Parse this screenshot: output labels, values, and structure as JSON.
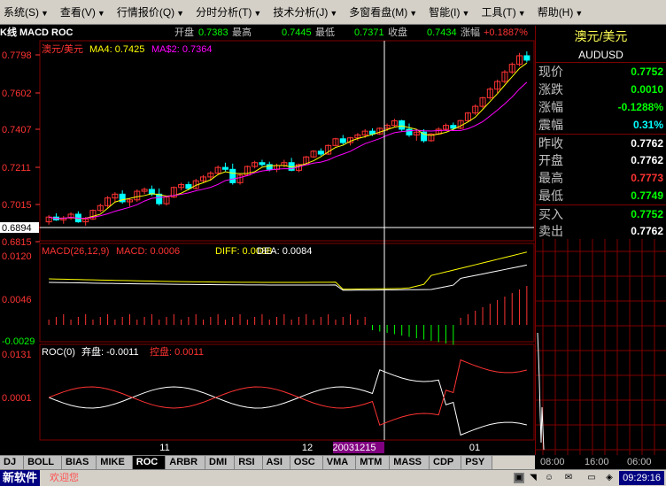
{
  "menu": [
    "系统(S)",
    "查看(V)",
    "行情报价(Q)",
    "分时分析(T)",
    "技术分析(J)",
    "多窗看盘(M)",
    "智能(I)",
    "工具(T)",
    "帮助(H)"
  ],
  "chart_header": {
    "title": "K线 MACD ROC",
    "open_label": "开盘",
    "open": "0.7383",
    "high_label": "最高",
    "high": "0.7445",
    "low_label": "最低",
    "low": "0.7371",
    "close_label": "收盘",
    "close": "0.7434",
    "change_label": "涨幅",
    "change": "+0.1887%"
  },
  "price_panel": {
    "name": "澳元/美元",
    "ma4_label": "MA4: 0.7425",
    "ma52_label": "MA$2: 0.7364",
    "y_ticks": [
      "0.7798",
      "0.7602",
      "0.7407",
      "0.7211",
      "0.7015",
      "0.6894",
      "0.6815"
    ]
  },
  "macd_panel": {
    "label": "MACD(26,12,9)",
    "macd": "MACD: 0.0006",
    "diff": "DIFF: 0.0088",
    "dea": "DEA: 0.0084",
    "y_ticks": [
      "0.0120",
      "0.0046",
      "-0.0029"
    ]
  },
  "roc_panel": {
    "label": "ROC(0)",
    "aband": "弃盘: -0.0011",
    "control": "控盘: 0.0011",
    "y_ticks": [
      "0.0131",
      "0.0001"
    ]
  },
  "x_axis": {
    "labels": [
      "11",
      "12",
      "20031215",
      "01"
    ]
  },
  "quote": {
    "name": "澳元/美元",
    "code": "AUDUSD",
    "rows": [
      {
        "label": "现价",
        "value": "0.7752",
        "color": "#00ff00"
      },
      {
        "label": "涨跌",
        "value": "0.0010",
        "color": "#00ff00"
      },
      {
        "label": "涨幅",
        "value": "-0.1288%",
        "color": "#00ff00"
      },
      {
        "label": "震幅",
        "value": "0.31%",
        "color": "#00ffff"
      },
      {
        "label": "昨收",
        "value": "0.7762",
        "color": "#ffffff"
      },
      {
        "label": "开盘",
        "value": "0.7762",
        "color": "#ffffff"
      },
      {
        "label": "最高",
        "value": "0.7773",
        "color": "#ff3333"
      },
      {
        "label": "最低",
        "value": "0.7749",
        "color": "#00ff00"
      },
      {
        "label": "买入",
        "value": "0.7752",
        "color": "#00ff00"
      },
      {
        "label": "卖出",
        "value": "0.7762",
        "color": "#ffffff"
      }
    ]
  },
  "tabs": [
    "DJ",
    "BOLL",
    "BIAS",
    "MIKE",
    "ROC",
    "ARBR",
    "DMI",
    "RSI",
    "ASI",
    "OSC",
    "VMA",
    "MTM",
    "MASS",
    "CDP",
    "PSY"
  ],
  "active_tab": "ROC",
  "time_axis": [
    "08:00",
    "16:00",
    "06:00"
  ],
  "status": {
    "brand": "新软件",
    "welcome": "欢迎您",
    "clock": "09:29:16"
  },
  "colors": {
    "up": "#ff3333",
    "down": "#00ffff",
    "frame": "#800000",
    "ma4": "#ffff00",
    "ma52": "#ff00ff",
    "dea": "#ffff00",
    "diff": "#ffffff"
  },
  "chart_data": {
    "type": "candlestick",
    "ylim": [
      0.6815,
      0.7798
    ],
    "candles": [
      [
        0.6905,
        0.694,
        0.689,
        0.693
      ],
      [
        0.693,
        0.695,
        0.691,
        0.6915
      ],
      [
        0.6915,
        0.6935,
        0.6895,
        0.6925
      ],
      [
        0.6925,
        0.6955,
        0.6915,
        0.6945
      ],
      [
        0.6945,
        0.696,
        0.69,
        0.6905
      ],
      [
        0.6905,
        0.693,
        0.6885,
        0.692
      ],
      [
        0.692,
        0.697,
        0.6915,
        0.6965
      ],
      [
        0.6965,
        0.7,
        0.6955,
        0.699
      ],
      [
        0.699,
        0.704,
        0.698,
        0.703
      ],
      [
        0.703,
        0.706,
        0.701,
        0.705
      ],
      [
        0.705,
        0.707,
        0.7,
        0.701
      ],
      [
        0.701,
        0.703,
        0.6985,
        0.702
      ],
      [
        0.702,
        0.7075,
        0.701,
        0.7065
      ],
      [
        0.7065,
        0.7085,
        0.705,
        0.7075
      ],
      [
        0.7075,
        0.7095,
        0.704,
        0.705
      ],
      [
        0.705,
        0.708,
        0.699,
        0.7
      ],
      [
        0.7,
        0.704,
        0.699,
        0.7035
      ],
      [
        0.7035,
        0.709,
        0.703,
        0.7085
      ],
      [
        0.7085,
        0.711,
        0.707,
        0.71
      ],
      [
        0.71,
        0.7115,
        0.707,
        0.708
      ],
      [
        0.708,
        0.713,
        0.7075,
        0.712
      ],
      [
        0.712,
        0.715,
        0.711,
        0.714
      ],
      [
        0.714,
        0.717,
        0.712,
        0.716
      ],
      [
        0.716,
        0.72,
        0.715,
        0.719
      ],
      [
        0.719,
        0.7215,
        0.717,
        0.718
      ],
      [
        0.718,
        0.721,
        0.71,
        0.711
      ],
      [
        0.711,
        0.716,
        0.71,
        0.715
      ],
      [
        0.715,
        0.72,
        0.7145,
        0.7195
      ],
      [
        0.7195,
        0.7225,
        0.7185,
        0.7215
      ],
      [
        0.7215,
        0.723,
        0.7195,
        0.7205
      ],
      [
        0.7205,
        0.722,
        0.717,
        0.718
      ],
      [
        0.718,
        0.721,
        0.7165,
        0.72
      ],
      [
        0.72,
        0.723,
        0.719,
        0.7215
      ],
      [
        0.7215,
        0.724,
        0.717,
        0.7175
      ],
      [
        0.7175,
        0.721,
        0.7165,
        0.7205
      ],
      [
        0.7205,
        0.725,
        0.72,
        0.7245
      ],
      [
        0.7245,
        0.728,
        0.724,
        0.7275
      ],
      [
        0.7275,
        0.729,
        0.725,
        0.726
      ],
      [
        0.726,
        0.731,
        0.7255,
        0.7305
      ],
      [
        0.7305,
        0.7345,
        0.73,
        0.734
      ],
      [
        0.734,
        0.736,
        0.731,
        0.732
      ],
      [
        0.732,
        0.735,
        0.7305,
        0.7345
      ],
      [
        0.7345,
        0.737,
        0.733,
        0.736
      ],
      [
        0.736,
        0.739,
        0.7345,
        0.738
      ],
      [
        0.738,
        0.7395,
        0.7355,
        0.7365
      ],
      [
        0.7365,
        0.74,
        0.736,
        0.7395
      ],
      [
        0.7395,
        0.742,
        0.738,
        0.741
      ],
      [
        0.741,
        0.7445,
        0.74,
        0.7434
      ],
      [
        0.7434,
        0.744,
        0.738,
        0.739
      ],
      [
        0.739,
        0.742,
        0.735,
        0.736
      ],
      [
        0.736,
        0.739,
        0.733,
        0.7375
      ],
      [
        0.7375,
        0.739,
        0.732,
        0.733
      ],
      [
        0.733,
        0.737,
        0.7325,
        0.7365
      ],
      [
        0.7365,
        0.74,
        0.736,
        0.739
      ],
      [
        0.739,
        0.742,
        0.738,
        0.741
      ],
      [
        0.741,
        0.7425,
        0.7385,
        0.7395
      ],
      [
        0.7395,
        0.744,
        0.739,
        0.7435
      ],
      [
        0.7435,
        0.748,
        0.743,
        0.7475
      ],
      [
        0.7475,
        0.752,
        0.7465,
        0.751
      ],
      [
        0.751,
        0.756,
        0.75,
        0.7555
      ],
      [
        0.7555,
        0.761,
        0.7545,
        0.76
      ],
      [
        0.76,
        0.765,
        0.758,
        0.764
      ],
      [
        0.764,
        0.77,
        0.763,
        0.769
      ],
      [
        0.769,
        0.774,
        0.768,
        0.773
      ],
      [
        0.773,
        0.779,
        0.772,
        0.7775
      ],
      [
        0.7775,
        0.7798,
        0.774,
        0.7752
      ]
    ]
  }
}
